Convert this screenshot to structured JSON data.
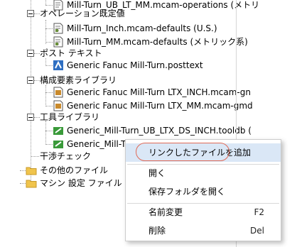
{
  "tree": {
    "items": [
      {
        "label": "Mill-Turn_UB_LT_MM.mcam-operations (メトリ",
        "icon": "defaults-file-icon"
      },
      {
        "label": "オペレーション既定値",
        "icon": "none"
      },
      {
        "label": "Mill-Turn_Inch.mcam-defaults (U.S.)",
        "icon": "defaults-file-icon"
      },
      {
        "label": "Mill-Turn_MM.mcam-defaults (メトリック系)",
        "icon": "defaults-file-icon"
      },
      {
        "label": "ポスト テキスト",
        "icon": "none"
      },
      {
        "label": "Generic Fanuc Mill-Turn.posttext",
        "icon": "posttext-icon"
      },
      {
        "label": "構成要素ライブラリ",
        "icon": "none"
      },
      {
        "label": "Generic Fanuc Mill-Turn LTX_INCH.mcam-gn",
        "icon": "component-library-icon"
      },
      {
        "label": "Generic Fanuc Mill-Turn LTX_MM.mcam-gmd",
        "icon": "component-library-icon"
      },
      {
        "label": "工具ライブラリ",
        "icon": "none"
      },
      {
        "label": "Generic_Mill-Turn_UB_LTX_DS_INCH.tooldb (",
        "icon": "tool-library-icon"
      },
      {
        "label": "Generic_Mill-Tu",
        "icon": "tool-library-icon"
      },
      {
        "label": "干渉チェック",
        "icon": "none"
      },
      {
        "label": "その他のファイル",
        "icon": "folder-icon"
      },
      {
        "label": "マシン 設定 ファイル",
        "icon": "folder-icon"
      }
    ]
  },
  "context_menu": {
    "add_linked_file": "リンクしたファイルを追加",
    "open": "開く",
    "open_containing_folder": "保存フォルダを開く",
    "rename": "名前変更",
    "rename_shortcut": "F2",
    "delete": "削除",
    "delete_shortcut": "Del"
  },
  "colors": {
    "menu_highlight": "#dae7f6",
    "annotation_circle": "#e06a57",
    "folder": "#f0c44c"
  }
}
